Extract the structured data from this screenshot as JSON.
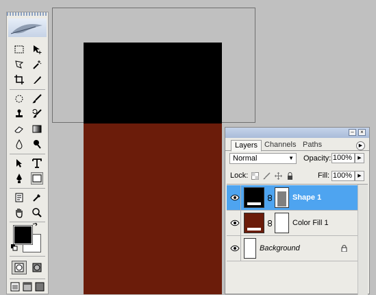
{
  "toolbox": {
    "tools": [
      "marquee",
      "move",
      "lasso",
      "magic-wand",
      "crop",
      "slice",
      "healing-brush",
      "brush",
      "clone-stamp",
      "history-brush",
      "eraser",
      "gradient",
      "blur",
      "dodge",
      "path-selection",
      "type",
      "pen",
      "rectangle-shape",
      "notes",
      "eyedropper",
      "hand",
      "zoom"
    ],
    "foreground_color": "#000000",
    "background_color": "#ffffff"
  },
  "canvas": {
    "shape1_color": "#000000",
    "fill_color": "#6b1c0a"
  },
  "layers_panel": {
    "tabs": [
      {
        "label": "Layers",
        "active": true
      },
      {
        "label": "Channels",
        "active": false
      },
      {
        "label": "Paths",
        "active": false
      }
    ],
    "blend_mode": "Normal",
    "opacity_label": "Opacity:",
    "opacity_value": "100%",
    "lock_label": "Lock:",
    "fill_label": "Fill:",
    "fill_value": "100%",
    "layers": [
      {
        "name": "Shape 1",
        "selected": true,
        "visible": true
      },
      {
        "name": "Color Fill 1",
        "selected": false,
        "visible": true
      },
      {
        "name": "Background",
        "selected": false,
        "visible": true,
        "locked": true
      }
    ]
  }
}
